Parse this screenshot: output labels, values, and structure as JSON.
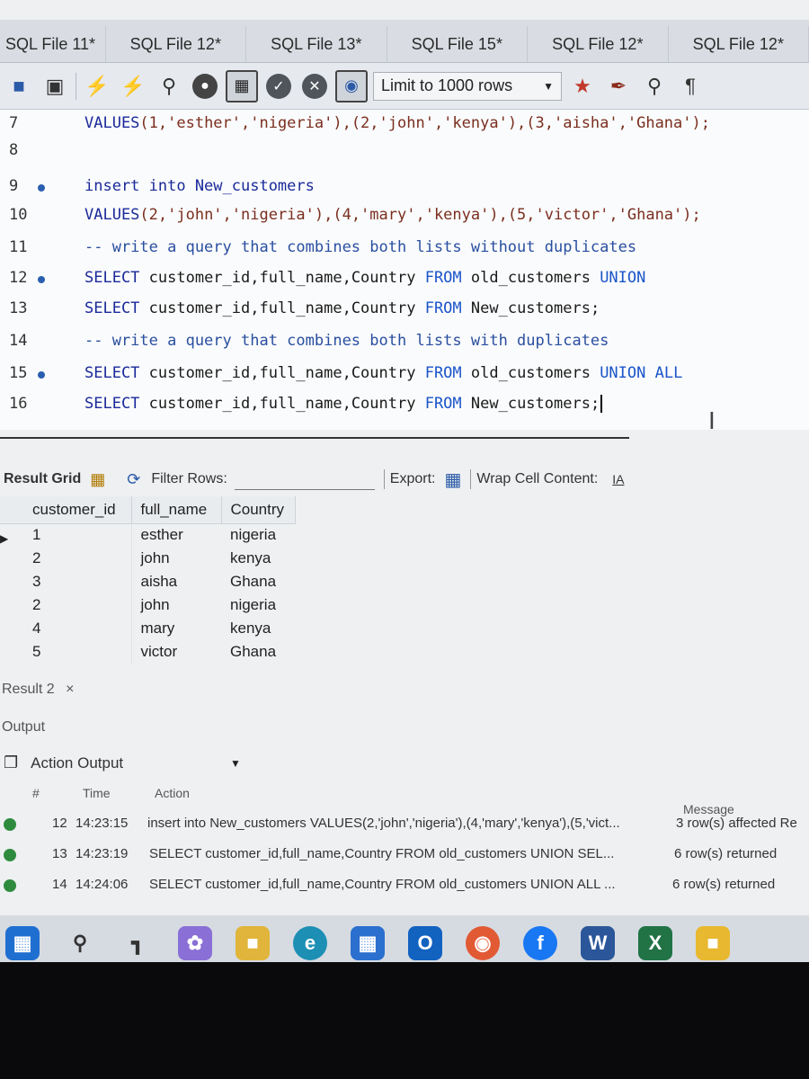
{
  "tabs": [
    "SQL File 11*",
    "SQL File 12*",
    "SQL File 13*",
    "SQL File 15*",
    "SQL File 12*",
    "SQL File 12*"
  ],
  "toolbar": {
    "limit_label": "Limit to 1000 rows",
    "icons": [
      "folder-icon",
      "save-icon",
      "lightning-icon",
      "lightning-cursor-icon",
      "magnifier-lightning-icon",
      "stop-icon",
      "toggle-output-icon",
      "check-icon",
      "cancel-icon",
      "beautify-icon",
      "bookmark-star-icon",
      "brush-icon",
      "search-icon",
      "invisible-chars-icon"
    ]
  },
  "editor": {
    "lines": [
      {
        "num": "7",
        "dot": false
      },
      {
        "num": "8",
        "dot": false
      },
      {
        "num": "9",
        "dot": true
      },
      {
        "num": "10",
        "dot": false
      },
      {
        "num": "11",
        "dot": false
      },
      {
        "num": "12",
        "dot": true
      },
      {
        "num": "13",
        "dot": false
      },
      {
        "num": "14",
        "dot": false
      },
      {
        "num": "15",
        "dot": true
      },
      {
        "num": "16",
        "dot": false
      }
    ],
    "code": {
      "l7_kw": "VALUES",
      "l7_rest": "(1,'esther','nigeria'),(2,'john','kenya'),(3,'aisha','Ghana');",
      "l9": "insert into New_customers",
      "l10_kw": "VALUES",
      "l10_rest": "(2,'john','nigeria'),(4,'mary','kenya'),(5,'victor','Ghana');",
      "l11": "-- write a query that combines both lists without duplicates",
      "l12_select": "SELECT",
      "l12_cols": " customer_id,full_name,Country ",
      "l12_from": "FROM",
      "l12_table": " old_customers ",
      "l12_union": "UNION",
      "l13_select": "SELECT",
      "l13_cols": " customer_id,full_name,Country ",
      "l13_from": "FROM",
      "l13_table": " New_customers;",
      "l14": "-- write a query that combines both lists with duplicates",
      "l15_select": "SELECT",
      "l15_cols": " customer_id,full_name,Country ",
      "l15_from": "FROM",
      "l15_table": " old_customers ",
      "l15_union": "UNION ALL",
      "l16_select": "SELECT",
      "l16_cols": " customer_id,full_name,Country ",
      "l16_from": "FROM",
      "l16_table": " New_customers;"
    }
  },
  "result": {
    "grid_label": "Result Grid",
    "filter_label": "Filter Rows:",
    "export_label": "Export:",
    "wrap_label": "Wrap Cell Content:",
    "wrap_icon_text": "IA",
    "columns": [
      "customer_id",
      "full_name",
      "Country"
    ],
    "rows": [
      [
        "1",
        "esther",
        "nigeria"
      ],
      [
        "2",
        "john",
        "kenya"
      ],
      [
        "3",
        "aisha",
        "Ghana"
      ],
      [
        "2",
        "john",
        "nigeria"
      ],
      [
        "4",
        "mary",
        "kenya"
      ],
      [
        "5",
        "victor",
        "Ghana"
      ]
    ],
    "result2_tab": "Result 2",
    "close_glyph": "×"
  },
  "output": {
    "label": "Output",
    "action_output": "Action Output",
    "headers": {
      "num": "#",
      "time": "Time",
      "action": "Action",
      "message": "Message"
    },
    "rows": [
      {
        "num": "12",
        "time": "14:23:15",
        "action": "insert into New_customers VALUES(2,'john','nigeria'),(4,'mary','kenya'),(5,'vict...",
        "message": "3 row(s) affected Re"
      },
      {
        "num": "13",
        "time": "14:23:19",
        "action": "SELECT customer_id,full_name,Country FROM old_customers UNION SEL...",
        "message": "6 row(s) returned"
      },
      {
        "num": "14",
        "time": "14:24:06",
        "action": "SELECT customer_id,full_name,Country FROM old_customers UNION ALL ...",
        "message": "6 row(s) returned"
      }
    ]
  },
  "taskbar": {
    "apps": [
      "windows-start-icon",
      "search-icon",
      "task-view-icon",
      "copilot-icon",
      "file-explorer-icon",
      "edge-icon",
      "store-icon",
      "outlook-icon",
      "chrome-icon",
      "facebook-icon",
      "word-icon",
      "excel-icon",
      "notes-icon",
      "whatsapp-icon"
    ],
    "labels": {
      "outlook": "O",
      "facebook": "f",
      "word": "W",
      "excel": "X"
    }
  }
}
